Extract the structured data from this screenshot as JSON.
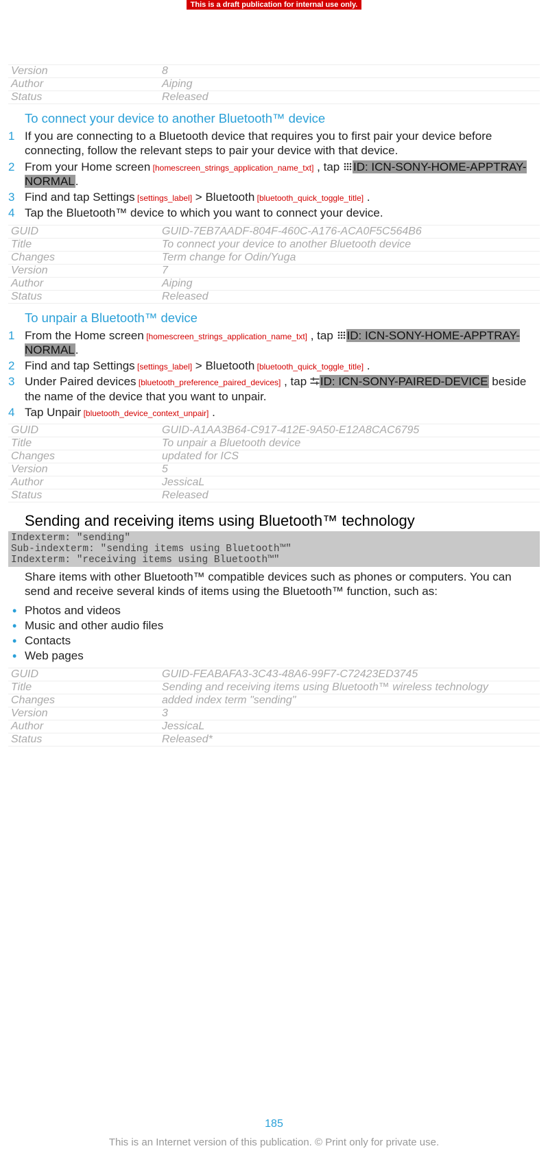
{
  "banner": "This is a draft publication for internal use only.",
  "pageNumber": "185",
  "footer": "This is an Internet version of this publication. © Print only for private use.",
  "topMeta": {
    "rows": [
      {
        "k": "Version",
        "v": "8"
      },
      {
        "k": "Author",
        "v": "Aiping"
      },
      {
        "k": "Status",
        "v": "Released"
      }
    ]
  },
  "sec1": {
    "title": "To connect your device to another Bluetooth™ device",
    "steps": {
      "s1": "If you are connecting to a Bluetooth device that requires you to first pair your device before connecting, follow the relevant steps to pair your device with that device.",
      "s2_a": "From your ",
      "s2_home": "Home screen",
      "s2_home_ref": " [homescreen_strings_application_name_txt]",
      "s2_b": " , tap ",
      "s2_hl": "ID: ICN-SONY-HOME-APPTRAY-NORMAL",
      "s2_c": ".",
      "s3_a": "Find and tap ",
      "s3_settings": "Settings",
      "s3_settings_ref": " [settings_label]",
      "s3_gt": " > ",
      "s3_bt": "Bluetooth",
      "s3_bt_ref": " [bluetooth_quick_toggle_title]",
      "s3_c": " .",
      "s4": "Tap the Bluetooth™ device to which you want to connect your device."
    },
    "meta": {
      "rows": [
        {
          "k": "GUID",
          "v": "GUID-7EB7AADF-804F-460C-A176-ACA0F5C564B6"
        },
        {
          "k": "Title",
          "v": "To connect your device to another Bluetooth device"
        },
        {
          "k": "Changes",
          "v": "Term change for Odin/Yuga"
        },
        {
          "k": "Version",
          "v": "7"
        },
        {
          "k": "Author",
          "v": "Aiping"
        },
        {
          "k": "Status",
          "v": "Released"
        }
      ]
    }
  },
  "sec2": {
    "title": "To unpair a Bluetooth™ device",
    "steps": {
      "s1_a": "From the ",
      "s1_home": "Home screen",
      "s1_home_ref": " [homescreen_strings_application_name_txt]",
      "s1_b": " , tap ",
      "s1_hl": "ID: ICN-SONY-HOME-APPTRAY-NORMAL",
      "s1_c": ".",
      "s2_a": "Find and tap ",
      "s2_settings": "Settings",
      "s2_settings_ref": " [settings_label]",
      "s2_gt": " > ",
      "s2_bt": "Bluetooth",
      "s2_bt_ref": " [bluetooth_quick_toggle_title]",
      "s2_c": " .",
      "s3_a": "Under ",
      "s3_paired": "Paired devices",
      "s3_paired_ref": " [bluetooth_preference_paired_devices]",
      "s3_b": " , tap ",
      "s3_hl": "ID: ICN-SONY-PAIRED-DEVICE",
      "s3_c": " beside the name of the device that you want to unpair.",
      "s4_a": "Tap ",
      "s4_unpair": "Unpair",
      "s4_unpair_ref": " [bluetooth_device_context_unpair]",
      "s4_c": " ."
    },
    "meta": {
      "rows": [
        {
          "k": "GUID",
          "v": "GUID-A1AA3B64-C917-412E-9A50-E12A8CAC6795"
        },
        {
          "k": "Title",
          "v": "To unpair a Bluetooth device"
        },
        {
          "k": "Changes",
          "v": "updated for ICS"
        },
        {
          "k": "Version",
          "v": "5"
        },
        {
          "k": "Author",
          "v": "JessicaL"
        },
        {
          "k": "Status",
          "v": "Released"
        }
      ]
    }
  },
  "sec3": {
    "title": "Sending and receiving items using Bluetooth™ technology",
    "indexterm": "Indexterm: \"sending\"\nSub-indexterm: \"sending items using Bluetooth™\"\nIndexterm: \"receiving items using Bluetooth™\"",
    "para": "Share items with other Bluetooth™ compatible devices such as phones or computers. You can send and receive several kinds of items using the Bluetooth™ function, such as:",
    "bullets": [
      "Photos and videos",
      "Music and other audio files",
      "Contacts",
      "Web pages"
    ],
    "meta": {
      "rows": [
        {
          "k": "GUID",
          "v": "GUID-FEABAFA3-3C43-48A6-99F7-C72423ED3745"
        },
        {
          "k": "Title",
          "v": "Sending and receiving items using Bluetooth™ wireless technology"
        },
        {
          "k": "Changes",
          "v": "added index term \"sending\""
        },
        {
          "k": "Version",
          "v": "3"
        },
        {
          "k": "Author",
          "v": "JessicaL"
        },
        {
          "k": "Status",
          "v": "Released*"
        }
      ]
    }
  }
}
